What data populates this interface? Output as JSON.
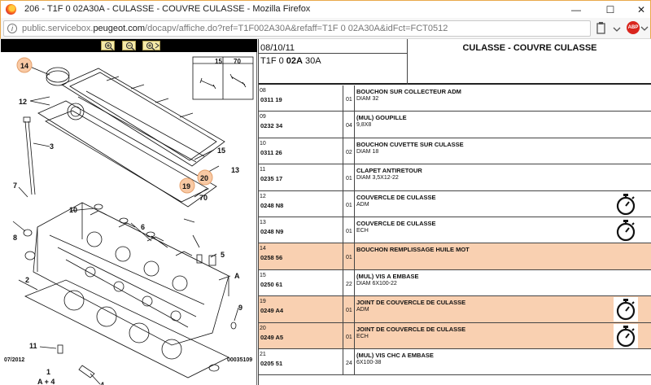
{
  "window": {
    "title": "206 - T1F 0 02A30A - CULASSE - COUVRE CULASSE - Mozilla Firefox",
    "url_host": "public.servicebox.",
    "url_domain": "peugeot.com",
    "url_path": "/docapv/affiche.do?ref=T1F002A30A&refaff=T1F 0 02A30A&idFct=FCT0512"
  },
  "toolbar": {
    "abp_label": "ABP"
  },
  "diagram": {
    "date_code": "07/2012",
    "ref_code": "00035109",
    "box_left": "15",
    "box_right": "70",
    "callouts": [
      "14",
      "12",
      "3",
      "7",
      "8",
      "2",
      "11",
      "1",
      "A + 4",
      "10",
      "6",
      "5",
      "9",
      "A",
      "4",
      "15",
      "13",
      "20",
      "19",
      "70"
    ]
  },
  "header": {
    "date": "08/10/11",
    "ref_prefix": "T1F 0 ",
    "ref_bold": "02A",
    "ref_suffix": " 30A",
    "title": "CULASSE - COUVRE CULASSE"
  },
  "rows": [
    {
      "seq": "08",
      "code": "0311 19",
      "qty": "01",
      "desc": "BOUCHON SUR COLLECTEUR ADM",
      "sub": "DIAM 32",
      "hl": false,
      "timer": false
    },
    {
      "seq": "09",
      "code": "0232 34",
      "qty": "04",
      "desc": "(MUL) GOUPILLE",
      "sub": "9,8X8",
      "hl": false,
      "timer": false
    },
    {
      "seq": "10",
      "code": "0311 26",
      "qty": "02",
      "desc": "BOUCHON CUVETTE SUR CULASSE",
      "sub": "DIAM 18",
      "hl": false,
      "timer": false
    },
    {
      "seq": "11",
      "code": "0235 17",
      "qty": "01",
      "desc": "CLAPET ANTIRETOUR",
      "sub": "DIAM 3,5X12-22",
      "hl": false,
      "timer": false
    },
    {
      "seq": "12",
      "code": "0248 N8",
      "qty": "01",
      "desc": "COUVERCLE DE CULASSE",
      "sub": "ADM",
      "hl": false,
      "timer": true
    },
    {
      "seq": "13",
      "code": "0248 N9",
      "qty": "01",
      "desc": "COUVERCLE DE CULASSE",
      "sub": "ECH",
      "hl": false,
      "timer": true
    },
    {
      "seq": "14",
      "code": "0258 56",
      "qty": "01",
      "desc": "BOUCHON REMPLISSAGE HUILE MOT",
      "sub": "",
      "hl": true,
      "timer": false
    },
    {
      "seq": "15",
      "code": "0250 61",
      "qty": "22",
      "desc": "(MUL) VIS A EMBASE",
      "sub": "DIAM 6X100-22",
      "hl": false,
      "timer": false
    },
    {
      "seq": "19",
      "code": "0249 A4",
      "qty": "01",
      "desc": "JOINT DE COUVERCLE DE CULASSE",
      "sub": "ADM",
      "hl": true,
      "timer": true
    },
    {
      "seq": "20",
      "code": "0249 A5",
      "qty": "01",
      "desc": "JOINT DE COUVERCLE DE CULASSE",
      "sub": "ECH",
      "hl": true,
      "timer": true
    },
    {
      "seq": "21",
      "code": "0205 51",
      "qty": "24",
      "desc": "(MUL) VIS CHC A EMBASE",
      "sub": "6X100-38",
      "hl": false,
      "timer": false
    }
  ]
}
